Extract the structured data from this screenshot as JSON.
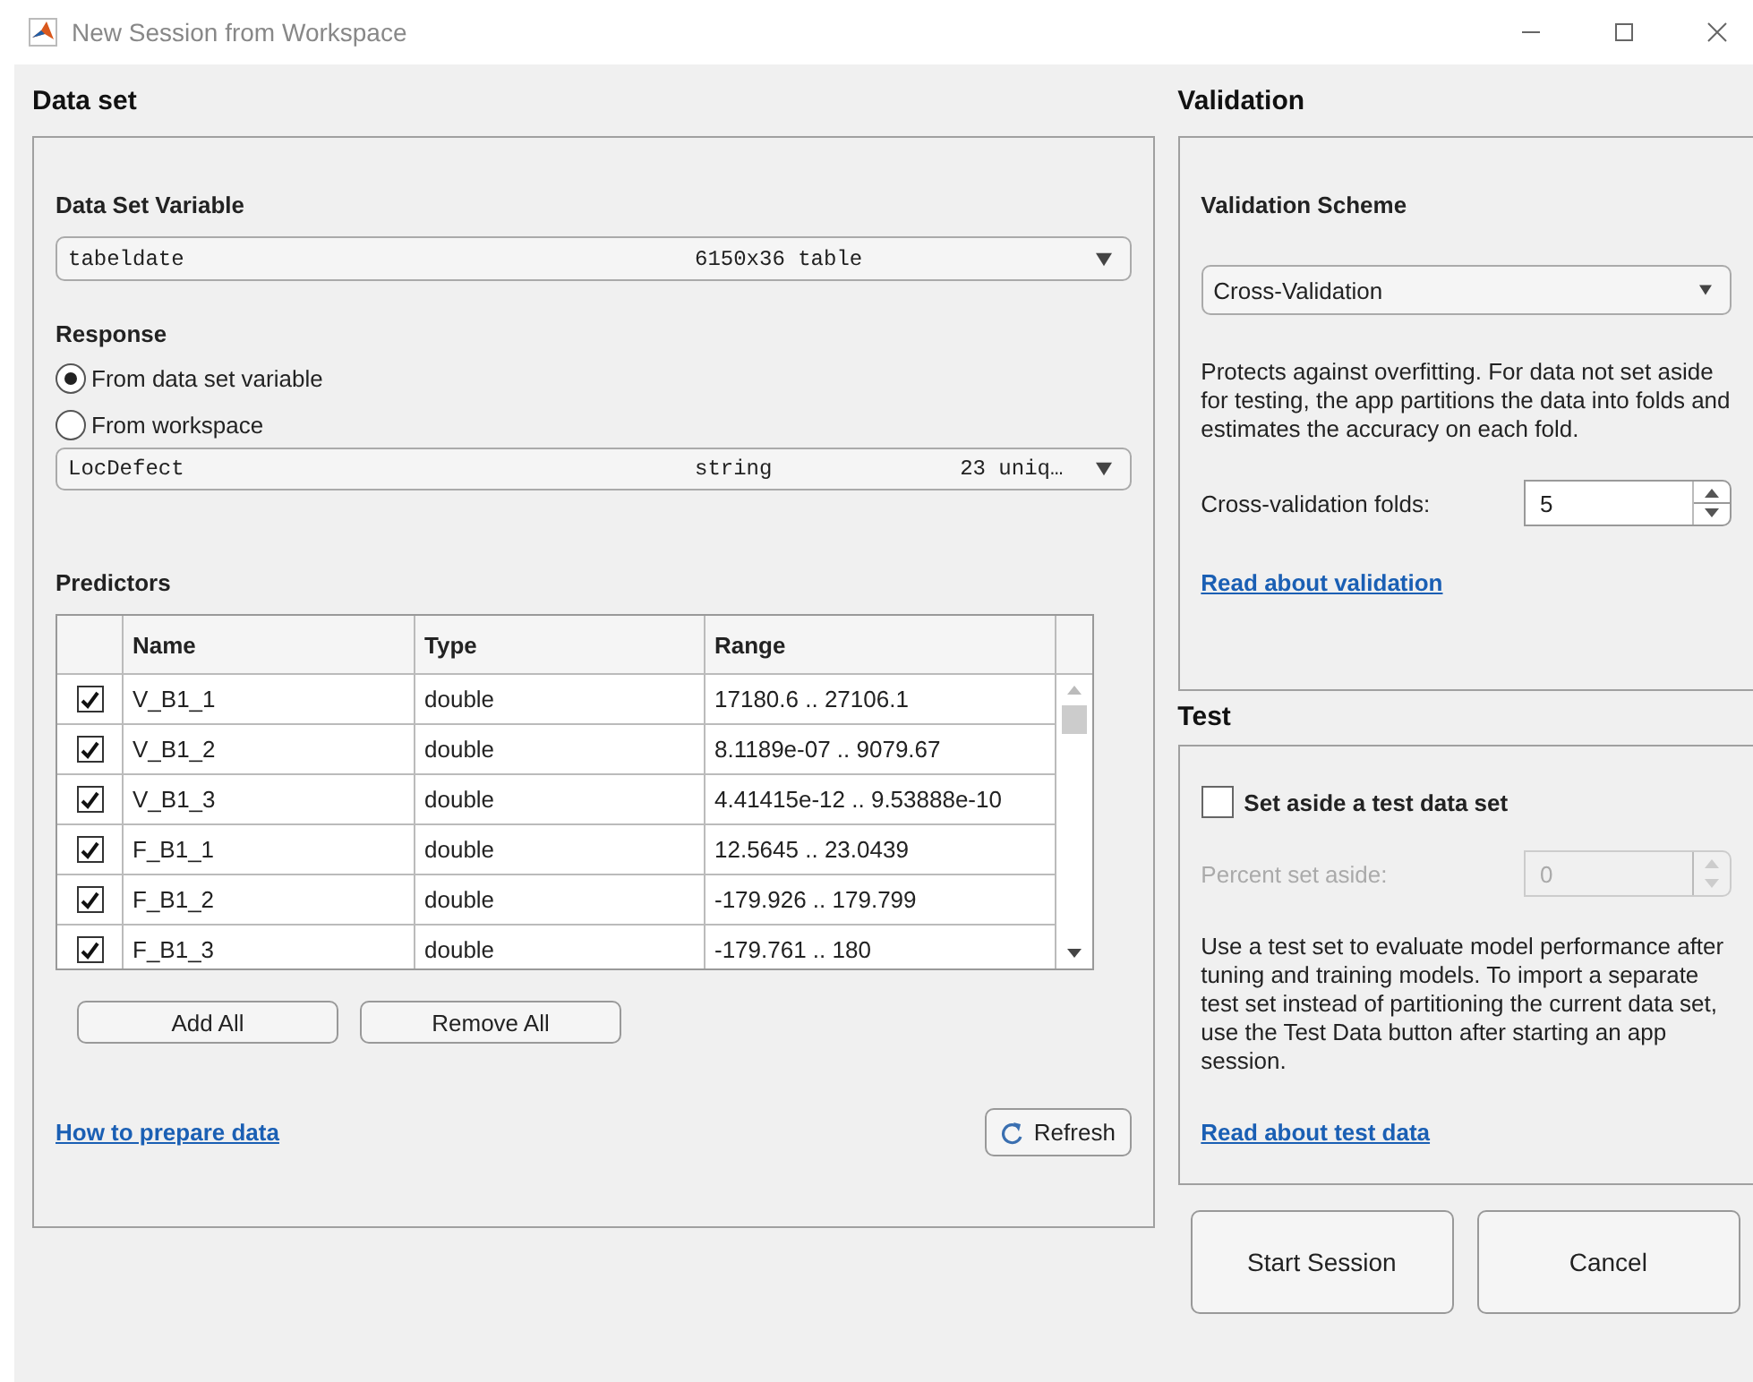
{
  "window": {
    "title": "New Session from Workspace"
  },
  "data_set": {
    "title": "Data set",
    "variable_label": "Data Set Variable",
    "variable": {
      "name": "tabeldate",
      "size": "6150x36 table"
    },
    "response_label": "Response",
    "response_options": [
      {
        "label": "From data set variable",
        "selected": true
      },
      {
        "label": "From workspace",
        "selected": false
      }
    ],
    "response": {
      "name": "LocDefect",
      "type": "string",
      "info": "23 uniq…"
    },
    "predictors_label": "Predictors",
    "columns": [
      "Name",
      "Type",
      "Range"
    ],
    "rows": [
      {
        "checked": true,
        "name": "V_B1_1",
        "type": "double",
        "range": "17180.6 .. 27106.1"
      },
      {
        "checked": true,
        "name": "V_B1_2",
        "type": "double",
        "range": "8.1189e-07 .. 9079.67"
      },
      {
        "checked": true,
        "name": "V_B1_3",
        "type": "double",
        "range": "4.41415e-12 .. 9.53888e-10"
      },
      {
        "checked": true,
        "name": "F_B1_1",
        "type": "double",
        "range": "12.5645 .. 23.0439"
      },
      {
        "checked": true,
        "name": "F_B1_2",
        "type": "double",
        "range": "-179.926 .. 179.799"
      },
      {
        "checked": true,
        "name": "F_B1_3",
        "type": "double",
        "range": "-179.761 .. 180"
      }
    ],
    "buttons": [
      "Add All",
      "Remove All"
    ],
    "link": "How to prepare data",
    "refresh": "Refresh"
  },
  "validation": {
    "title": "Validation",
    "scheme_label": "Validation Scheme",
    "scheme": "Cross-Validation",
    "description": "Protects against overfitting. For data not set aside for testing, the app partitions the data into folds and estimates the accuracy on each fold.",
    "folds_label": "Cross-validation folds:",
    "folds": "5",
    "link": "Read about validation"
  },
  "test": {
    "title": "Test",
    "checkbox": {
      "label": "Set aside a test data set",
      "checked": false
    },
    "percent_label": "Percent set aside:",
    "percent": "0",
    "percent_disabled": true,
    "description": "Use a test set to evaluate model performance after tuning and training models. To import a separate test set instead of partitioning the current data set, use the Test Data button after starting an app session.",
    "link": "Read about test data"
  },
  "footer_buttons": [
    "Start Session",
    "Cancel"
  ]
}
